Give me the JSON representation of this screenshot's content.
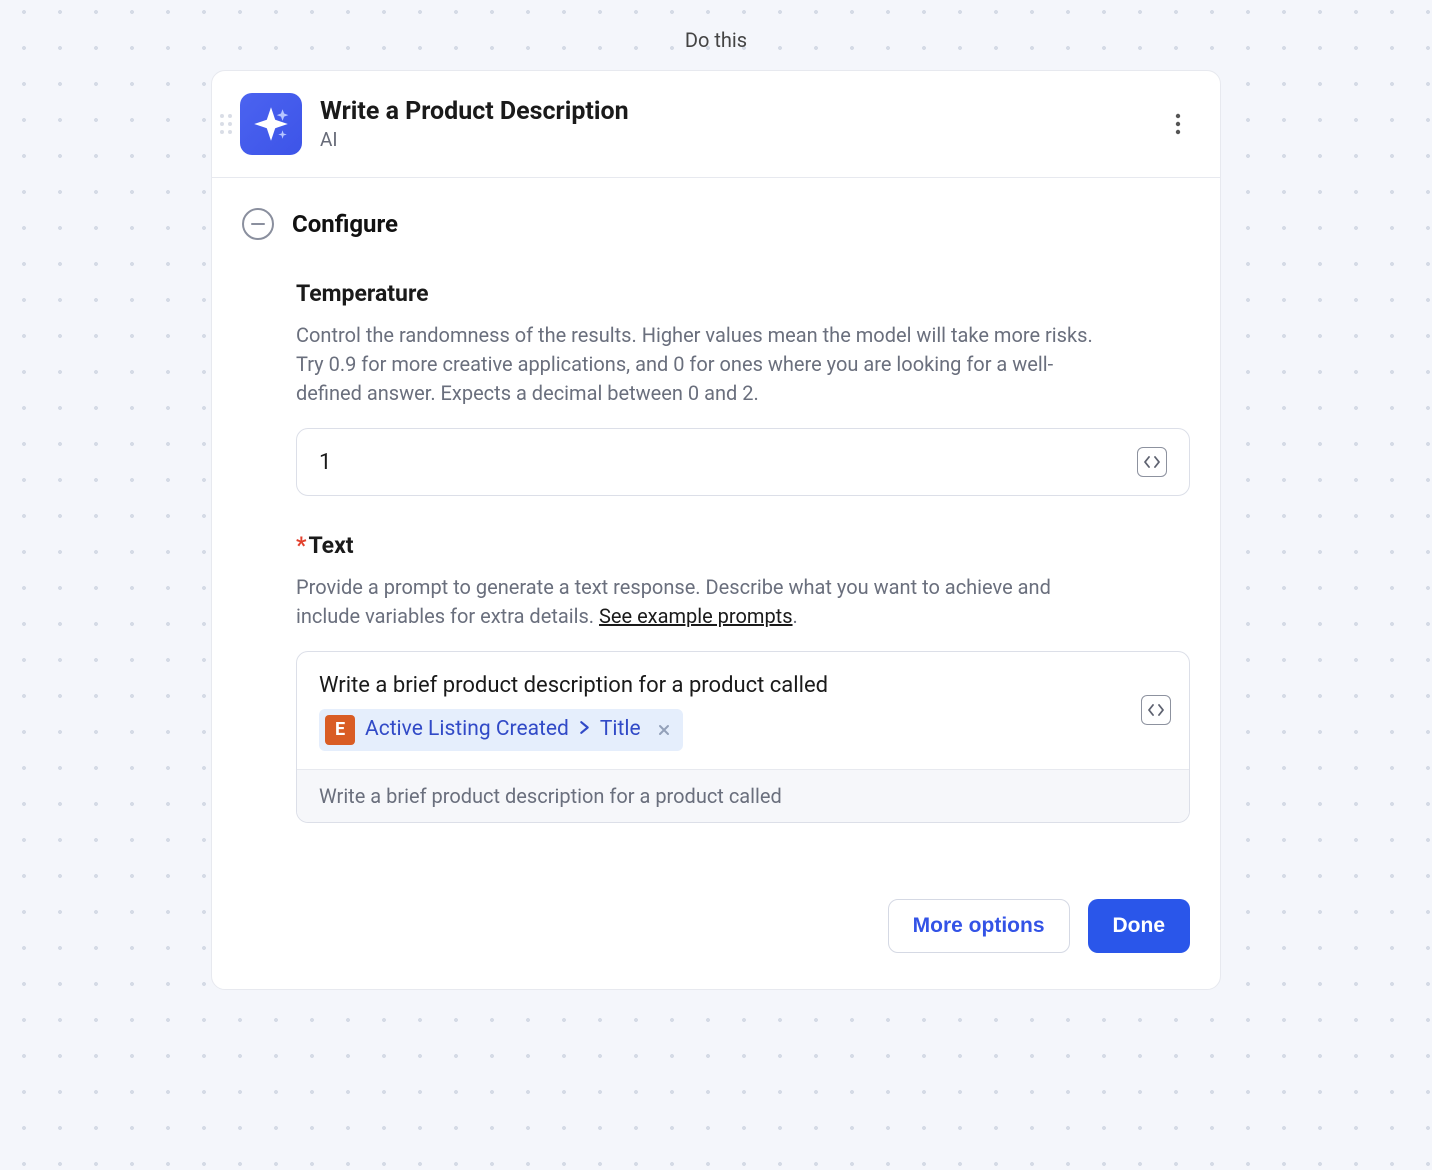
{
  "page_label": "Do this",
  "header": {
    "title": "Write a Product Description",
    "subtitle": "AI"
  },
  "section": {
    "configure_label": "Configure"
  },
  "fields": {
    "temperature": {
      "label": "Temperature",
      "description": "Control the randomness of the results. Higher values mean the model will take more risks. Try 0.9 for more creative applications, and 0 for ones where you are looking for a well-defined answer. Expects a decimal between 0 and 2.",
      "value": "1"
    },
    "text": {
      "required_marker": "*",
      "label": "Text",
      "description_pre": "Provide a prompt to generate a text response. Describe what you want to achieve and include variables for extra details. ",
      "description_link": "See example prompts",
      "description_post": ".",
      "pre_text": "Write a brief product description for a product called",
      "pill": {
        "badge": "E",
        "segment1": "Active Listing Created",
        "segment2": "Title"
      },
      "footer_echo": "Write a brief product description for a product called"
    }
  },
  "actions": {
    "more_options": "More options",
    "done": "Done"
  }
}
